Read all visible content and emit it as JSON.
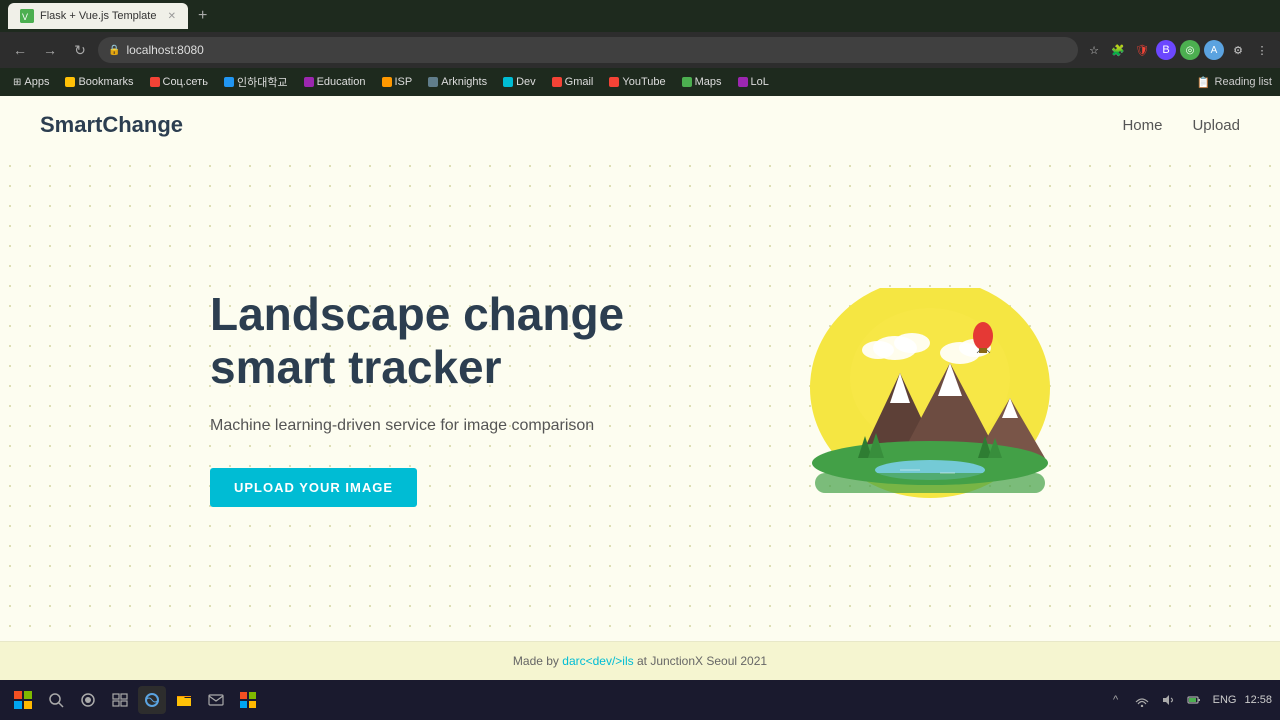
{
  "browser": {
    "tab_label": "Flask + Vue.js Template",
    "url": "localhost:8080",
    "bookmarks": [
      {
        "label": "Apps",
        "color": "#4CAF50"
      },
      {
        "label": "Bookmarks",
        "color": "#FFC107"
      },
      {
        "label": "Соц.сеть",
        "color": "#f44336"
      },
      {
        "label": "인하대학교",
        "color": "#2196F3"
      },
      {
        "label": "Education",
        "color": "#9C27B0"
      },
      {
        "label": "ISP",
        "color": "#FF9800"
      },
      {
        "label": "Arknights",
        "color": "#607D8B"
      },
      {
        "label": "Dev",
        "color": "#00BCD4"
      },
      {
        "label": "Gmail",
        "color": "#f44336"
      },
      {
        "label": "YouTube",
        "color": "#f44336"
      },
      {
        "label": "Maps",
        "color": "#4CAF50"
      },
      {
        "label": "LoL",
        "color": "#9C27B0"
      }
    ],
    "reading_list": "Reading list"
  },
  "navbar": {
    "brand": "SmartChange",
    "links": [
      {
        "label": "Home"
      },
      {
        "label": "Upload"
      }
    ]
  },
  "hero": {
    "title_line1": "Landscape change",
    "title_line2": "smart tracker",
    "subtitle": "Machine learning-driven service for image comparison",
    "cta_button": "UPLOAD YOUR IMAGE"
  },
  "footer": {
    "text_before": "Made by ",
    "author": "darc<dev/>ils",
    "text_after": " at JunctionX Seoul 2021"
  },
  "taskbar": {
    "time": "12:58",
    "language": "ENG"
  }
}
